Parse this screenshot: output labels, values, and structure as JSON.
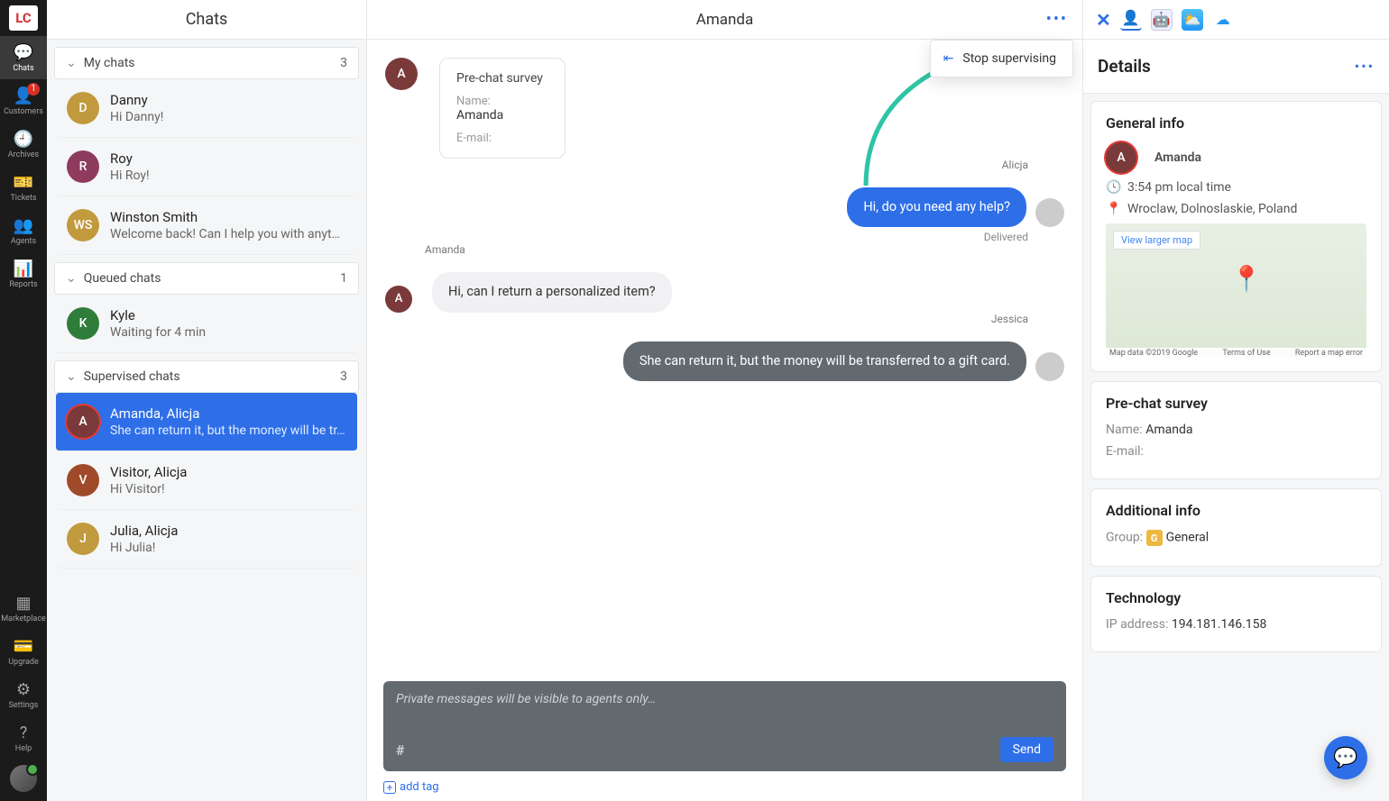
{
  "nav": {
    "items": [
      {
        "label": "Chats",
        "badge": null,
        "active": true
      },
      {
        "label": "Customers",
        "badge": "1"
      },
      {
        "label": "Archives",
        "badge": null
      },
      {
        "label": "Tickets",
        "badge": null
      },
      {
        "label": "Agents",
        "badge": null
      },
      {
        "label": "Reports",
        "badge": null
      }
    ],
    "bottom": [
      {
        "label": "Marketplace"
      },
      {
        "label": "Upgrade"
      },
      {
        "label": "Settings"
      },
      {
        "label": "Help"
      }
    ]
  },
  "chats": {
    "header": "Chats",
    "sections": [
      {
        "title": "My chats",
        "count": "3",
        "items": [
          {
            "initials": "D",
            "color": "#c19a3e",
            "title": "Danny",
            "preview": "Hi Danny!"
          },
          {
            "initials": "R",
            "color": "#8e3b5e",
            "title": "Roy",
            "preview": "Hi Roy!"
          },
          {
            "initials": "WS",
            "color": "#c19a3e",
            "title": "Winston Smith",
            "preview": "Welcome back! Can I help you with anythi…"
          }
        ]
      },
      {
        "title": "Queued chats",
        "count": "1",
        "items": [
          {
            "initials": "K",
            "color": "#2f7d3b",
            "title": "Kyle",
            "preview": "Waiting for 4 min"
          }
        ]
      },
      {
        "title": "Supervised chats",
        "count": "3",
        "items": [
          {
            "initials": "A",
            "color": "#7a3a3a",
            "title": "Amanda, Alicja",
            "preview": "She can return it, but the money will be tr…",
            "selected": true,
            "ring": true
          },
          {
            "initials": "V",
            "color": "#a04a2a",
            "title": "Visitor, Alicja",
            "preview": "Hi Visitor!"
          },
          {
            "initials": "J",
            "color": "#c19a3e",
            "title": "Julia, Alicja",
            "preview": "Hi Julia!"
          }
        ]
      }
    ]
  },
  "conversation": {
    "title": "Amanda",
    "dropdown": "Stop supervising",
    "survey": {
      "header": "Pre-chat survey",
      "name_label": "Name:",
      "name_value": "Amanda",
      "email_label": "E-mail:"
    },
    "messages": [
      {
        "side": "right",
        "author": "Alicja",
        "text": "Hi, do you need any help?",
        "style": "blue",
        "delivered": "Delivered"
      },
      {
        "side": "left",
        "author": "Amanda",
        "text": "Hi, can I return a personalized item?",
        "style": "light"
      },
      {
        "side": "right",
        "author": "Jessica",
        "text": "She can return it, but the money will be transferred to a gift card.",
        "style": "dark"
      }
    ],
    "composer_placeholder": "Private messages will be visible to agents only…",
    "send_label": "Send",
    "add_tag": "add tag"
  },
  "details": {
    "header": "Details",
    "general": {
      "title": "General info",
      "name": "Amanda",
      "time": "3:54 pm local time",
      "location": "Wroclaw, Dolnoslaskie, Poland",
      "map_link": "View larger map",
      "map_attrib": "Map data ©2019 Google",
      "map_terms": "Terms of Use",
      "map_error": "Report a map error"
    },
    "prechat": {
      "title": "Pre-chat survey",
      "name_label": "Name:",
      "name_value": "Amanda",
      "email_label": "E-mail:"
    },
    "additional": {
      "title": "Additional info",
      "group_label": "Group:",
      "group_value": "General"
    },
    "technology": {
      "title": "Technology",
      "ip_label": "IP address:",
      "ip_value": "194.181.146.158"
    }
  }
}
